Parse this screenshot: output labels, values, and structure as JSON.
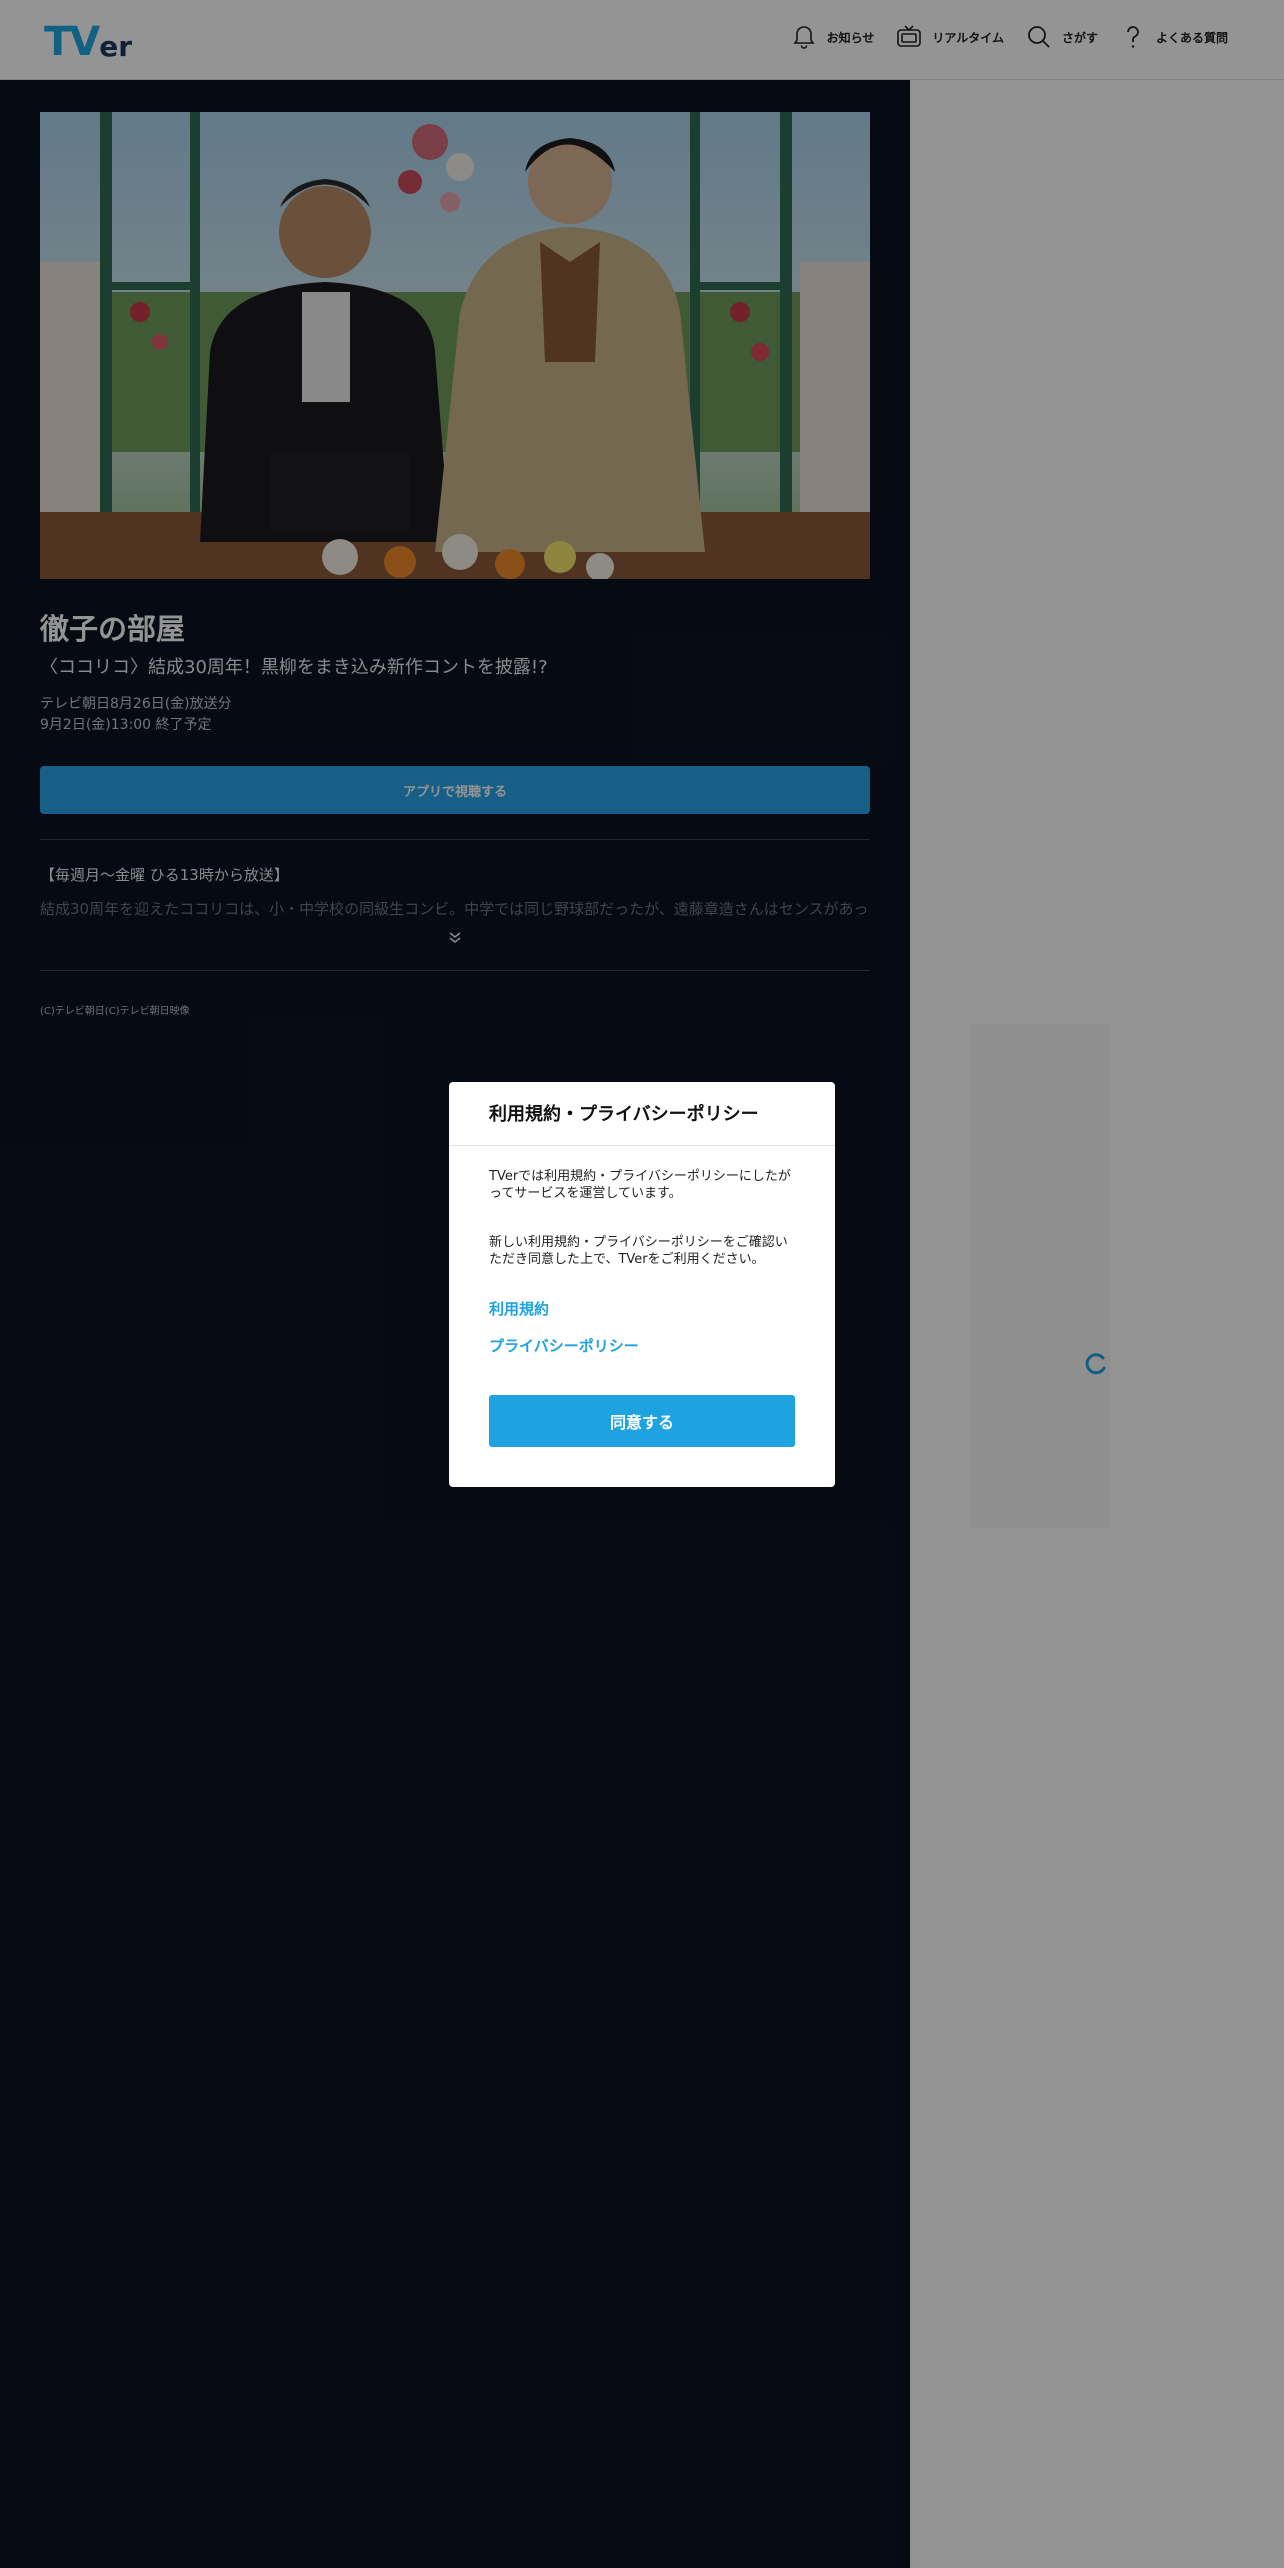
{
  "header": {
    "logo_main": "TV",
    "logo_sub": "er",
    "nav": [
      {
        "label": "お知らせ",
        "icon": "bell-icon"
      },
      {
        "label": "リアルタイム",
        "icon": "tv-icon"
      },
      {
        "label": "さがす",
        "icon": "search-icon"
      },
      {
        "label": "よくある質問",
        "icon": "question-icon"
      }
    ]
  },
  "episode": {
    "series_title": "徹子の部屋",
    "subtitle": "〈ココリコ〉結成30周年！黒柳をまき込み新作コントを披露!?",
    "broadcast": "テレビ朝日8月26日(金)放送分",
    "expiry": "9月2日(金)13:00 終了予定",
    "app_button": "アプリで視聴する",
    "description_heading": "【毎週月～金曜 ひる13時から放送】",
    "description_body": "結成30周年を迎えたココリコは、小・中学校の同級生コンビ。中学では同じ野球部だったが、遠藤章造さんはセンスがあった",
    "copyright": "(C)テレビ朝日(C)テレビ朝日映像"
  },
  "modal": {
    "title": "利用規約・プライバシーポリシー",
    "paragraph1": "TVerでは利用規約・プライバシーポリシーにしたがってサービスを運営しています。",
    "paragraph2": "新しい利用規約・プライバシーポリシーをご確認いただき同意した上で、TVerをご利用ください。",
    "link_terms": "利用規約",
    "link_privacy": "プライバシーポリシー",
    "agree_button": "同意する"
  },
  "colors": {
    "accent": "#1ea2e0",
    "main_background": "#0b1422"
  }
}
